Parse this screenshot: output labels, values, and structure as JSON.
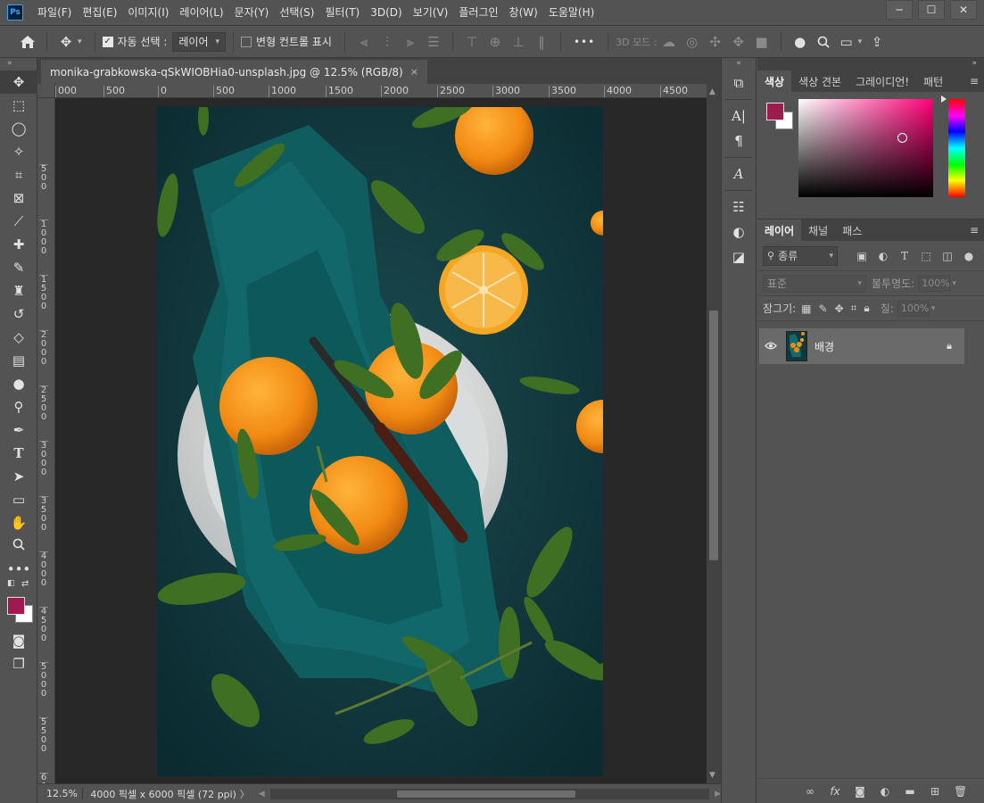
{
  "app": {
    "logo_text": "Ps"
  },
  "menu": [
    "파일(F)",
    "편집(E)",
    "이미지(I)",
    "레이어(L)",
    "문자(Y)",
    "선택(S)",
    "필터(T)",
    "3D(D)",
    "보기(V)",
    "플러그인",
    "창(W)",
    "도움말(H)"
  ],
  "window_controls": {
    "minimize": "─",
    "maximize": "☐",
    "close": "✕"
  },
  "options_bar": {
    "auto_select_label": "자동 선택 :",
    "auto_select_checked": true,
    "auto_select_target": "레이어",
    "transform_controls_label": "변형 컨트롤 표시",
    "transform_controls_checked": false,
    "more_label": "•••",
    "mode_3d_label": "3D 모드 :"
  },
  "document": {
    "tab_title": "monika-grabkowska-qSkWIOBHia0-unsplash.jpg @ 12.5% (RGB/8)",
    "tab_close": "×",
    "ruler_top": [
      "000",
      "500",
      "0",
      "500",
      "1000",
      "1500",
      "2000",
      "2500",
      "3000",
      "3500",
      "4000",
      "4500"
    ],
    "ruler_left": [
      [
        "5",
        "0",
        "0"
      ],
      [
        "1",
        "0",
        "0",
        "0"
      ],
      [
        "1",
        "5",
        "0",
        "0"
      ],
      [
        "2",
        "0",
        "0",
        "0"
      ],
      [
        "2",
        "5",
        "0",
        "0"
      ],
      [
        "3",
        "0",
        "0",
        "0"
      ],
      [
        "3",
        "5",
        "0",
        "0"
      ],
      [
        "4",
        "0",
        "0",
        "0"
      ],
      [
        "4",
        "5",
        "0",
        "0"
      ],
      [
        "5",
        "0",
        "0",
        "0"
      ],
      [
        "5",
        "5",
        "0",
        "0"
      ],
      [
        "6",
        "0",
        "0",
        "0"
      ]
    ]
  },
  "status": {
    "zoom": "12.5%",
    "info": "4000 픽셀 x 6000 픽셀 (72 ppi)",
    "arrow": "〉"
  },
  "colors": {
    "foreground": "#9c1c4f",
    "background": "#ffffff",
    "hue": "#ff0077"
  },
  "color_panel": {
    "tabs": [
      "색상",
      "색상 견본",
      "그레이디언!",
      "패턴"
    ]
  },
  "layers_panel": {
    "tabs": [
      "레이어",
      "채널",
      "패스"
    ],
    "filter_placeholder": "종류",
    "blend_mode": "표준",
    "opacity_label": "불투명도:",
    "opacity_value": "100%",
    "lock_label": "잠그기:",
    "fill_label": "칠:",
    "fill_value": "100%",
    "layers": [
      {
        "name": "배경",
        "visible": true,
        "locked": true
      }
    ]
  }
}
